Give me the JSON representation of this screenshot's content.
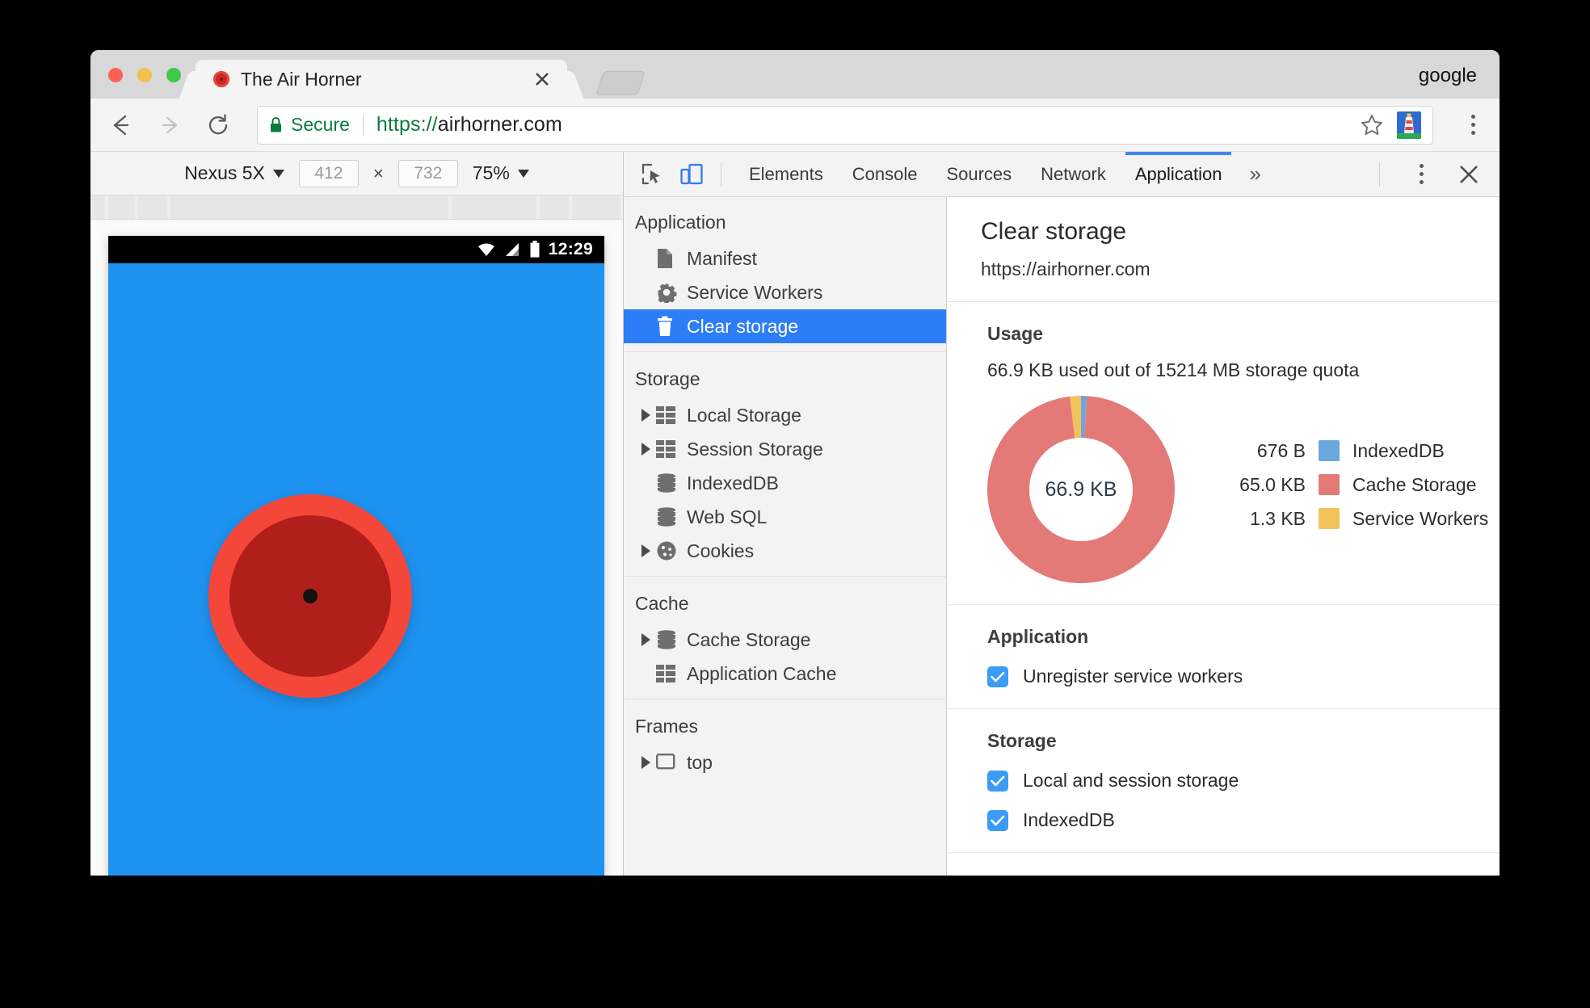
{
  "window": {
    "profile_label": "google",
    "traffic_lights": [
      "close",
      "minimize",
      "maximize"
    ]
  },
  "tab": {
    "title": "The Air Horner",
    "favicon": "air-horn-favicon",
    "close_icon": "close-icon",
    "new_tab_icon": "new-tab-icon"
  },
  "omnibox": {
    "back_icon": "back-arrow-icon",
    "forward_icon": "forward-arrow-icon",
    "reload_icon": "reload-icon",
    "lock_icon": "lock-icon",
    "security_label": "Secure",
    "url_scheme": "https://",
    "url_host": "airhorner.com",
    "url_full": "https://airhorner.com",
    "star_icon": "bookmark-star-icon",
    "extension_icon": "lighthouse-extension-icon",
    "menu_icon": "chrome-menu-icon"
  },
  "device_toolbar": {
    "device_name": "Nexus 5X",
    "device_caret_icon": "chevron-down-icon",
    "width_value": "412",
    "height_value": "732",
    "multiply_symbol": "×",
    "zoom_value": "75%",
    "zoom_caret_icon": "chevron-down-icon"
  },
  "device_screen": {
    "status_time": "12:29",
    "wifi_icon": "wifi-icon",
    "signal_icon": "cell-signal-icon",
    "battery_icon": "battery-icon",
    "page_background": "#1e92f0",
    "horn_outer_color": "#f4473a",
    "horn_inner_color": "#b11f1a",
    "horn_dot_color": "#121212"
  },
  "devtools": {
    "inspect_icon": "inspect-element-icon",
    "device_toggle_icon": "toggle-device-toolbar-icon",
    "tabs": [
      {
        "label": "Elements",
        "active": false
      },
      {
        "label": "Console",
        "active": false
      },
      {
        "label": "Sources",
        "active": false
      },
      {
        "label": "Network",
        "active": false
      },
      {
        "label": "Application",
        "active": true
      }
    ],
    "more_tabs_icon": "chevron-double-right-icon",
    "more_tabs_label": "»",
    "settings_icon": "devtools-menu-icon",
    "close_icon": "close-devtools-icon",
    "accent_color": "#4285f4"
  },
  "sidebar": {
    "sections": [
      {
        "header": "Application",
        "items": [
          {
            "label": "Manifest",
            "icon": "manifest-file-icon",
            "expandable": false,
            "selected": false
          },
          {
            "label": "Service Workers",
            "icon": "gear-icon",
            "expandable": false,
            "selected": false
          },
          {
            "label": "Clear storage",
            "icon": "trash-icon",
            "expandable": false,
            "selected": true
          }
        ]
      },
      {
        "header": "Storage",
        "items": [
          {
            "label": "Local Storage",
            "icon": "table-icon",
            "expandable": true,
            "selected": false
          },
          {
            "label": "Session Storage",
            "icon": "table-icon",
            "expandable": true,
            "selected": false
          },
          {
            "label": "IndexedDB",
            "icon": "database-icon",
            "expandable": false,
            "selected": false
          },
          {
            "label": "Web SQL",
            "icon": "database-icon",
            "expandable": false,
            "selected": false
          },
          {
            "label": "Cookies",
            "icon": "cookie-icon",
            "expandable": true,
            "selected": false
          }
        ]
      },
      {
        "header": "Cache",
        "items": [
          {
            "label": "Cache Storage",
            "icon": "database-icon",
            "expandable": true,
            "selected": false
          },
          {
            "label": "Application Cache",
            "icon": "table-icon",
            "expandable": false,
            "selected": false
          }
        ]
      },
      {
        "header": "Frames",
        "items": [
          {
            "label": "top",
            "icon": "frame-icon",
            "expandable": true,
            "selected": false
          }
        ]
      }
    ]
  },
  "panel": {
    "title": "Clear storage",
    "origin": "https://airhorner.com",
    "usage": {
      "title": "Usage",
      "summary": "66.9 KB used out of 15214 MB storage quota",
      "center_label": "66.9 KB"
    },
    "application_section": {
      "title": "Application",
      "options": [
        {
          "label": "Unregister service workers",
          "checked": true
        }
      ]
    },
    "storage_section": {
      "title": "Storage",
      "options": [
        {
          "label": "Local and session storage",
          "checked": true
        },
        {
          "label": "IndexedDB",
          "checked": true
        }
      ]
    }
  },
  "chart_data": {
    "type": "pie",
    "title": "Usage",
    "subtitle": "66.9 KB used out of 15214 MB storage quota",
    "center_label": "66.9 KB",
    "total_bytes": 68505,
    "total_label": "66.9 KB",
    "quota_label": "15214 MB",
    "legend_position": "right",
    "categories": [
      "IndexedDB",
      "Cache Storage",
      "Service Workers"
    ],
    "labels": [
      "676 B",
      "65.0 KB",
      "1.3 KB"
    ],
    "values": [
      676,
      66560,
      1331
    ],
    "percent": [
      0.99,
      97.1,
      1.94
    ],
    "colors": [
      "#6aa7dd",
      "#e37a78",
      "#f2c35b"
    ],
    "series": [
      {
        "name": "IndexedDB",
        "value": 676,
        "label": "676 B",
        "color": "#6aa7dd"
      },
      {
        "name": "Cache Storage",
        "value": 66560,
        "label": "65.0 KB",
        "color": "#e37a78"
      },
      {
        "name": "Service Workers",
        "value": 1331,
        "label": "1.3 KB",
        "color": "#f2c35b"
      }
    ],
    "donut": true,
    "inner_radius_ratio": 0.56,
    "grid": false
  }
}
